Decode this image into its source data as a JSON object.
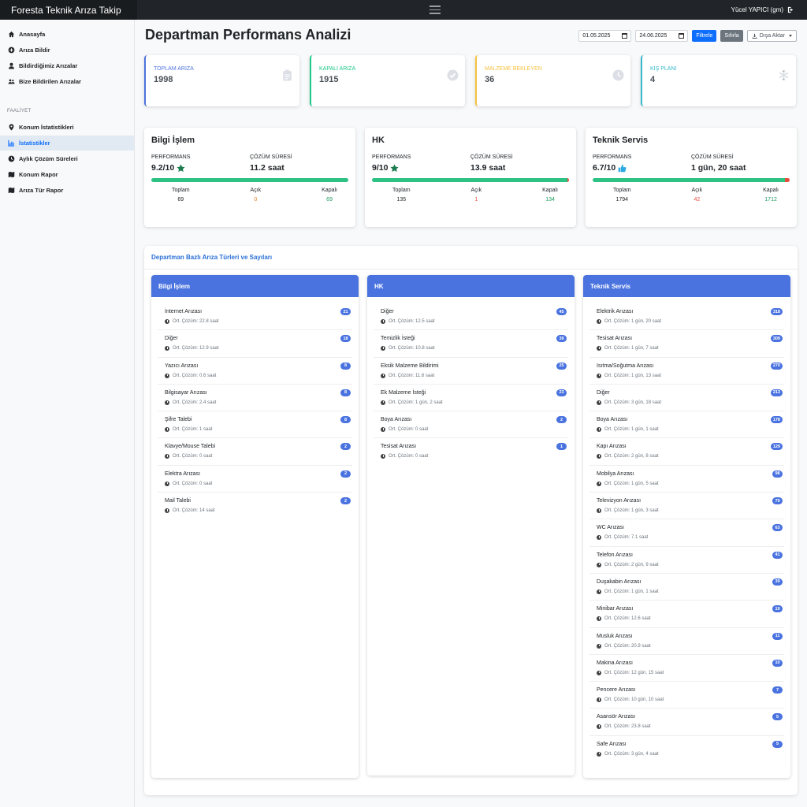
{
  "app": {
    "title": "Foresta Teknik Arıza Takip",
    "user": "Yücel YAPICI (gm)"
  },
  "sidebar": {
    "items": [
      {
        "label": "Anasayfa",
        "icon": "home-icon"
      },
      {
        "label": "Arıza Bildir",
        "icon": "plus-circle-icon"
      },
      {
        "label": "Bildirdiğimiz Arızalar",
        "icon": "user-icon"
      },
      {
        "label": "Bize Bildirilen Arızalar",
        "icon": "users-icon"
      }
    ],
    "heading": "FAALİYET",
    "activity": [
      {
        "label": "Konum İstatistikleri",
        "icon": "map-marker-icon"
      },
      {
        "label": "İstatistikler",
        "icon": "chart-icon",
        "active": true
      },
      {
        "label": "Aylık Çözüm Süreleri",
        "icon": "clock-icon"
      },
      {
        "label": "Konum Rapor",
        "icon": "map-icon"
      },
      {
        "label": "Arıza Tür Rapor",
        "icon": "map-icon"
      }
    ]
  },
  "page": {
    "title": "Departman Performans Analizi"
  },
  "filters": {
    "start_date": "01.05.2025",
    "end_date": "24.06.2025",
    "filter_label": "Filtrele",
    "reset_label": "Sıfırla",
    "export_label": "Dışa Aktar"
  },
  "stats": [
    {
      "label": "TOPLAM ARIZA",
      "value": "1998",
      "color": "#4e73df",
      "icon": "clipboard-icon"
    },
    {
      "label": "KAPALI ARIZA",
      "value": "1915",
      "color": "#1cc88a",
      "icon": "check-circle-icon"
    },
    {
      "label": "MALZEME BEKLEYEN",
      "value": "36",
      "color": "#f6c23e",
      "icon": "clock-icon"
    },
    {
      "label": "KIŞ PLANI",
      "value": "4",
      "color": "#36b9cc",
      "icon": "snowflake-icon"
    }
  ],
  "departments": [
    {
      "name": "Bilgi İşlem",
      "perf_label": "PERFORMANS",
      "perf": "9.2/10",
      "perf_icon": "star-icon",
      "time_label": "ÇÖZÜM SÜRESİ",
      "time": "11.2 saat",
      "total_label": "Toplam",
      "open_label": "Açık",
      "closed_label": "Kapalı",
      "total": "69",
      "open": "0",
      "closed": "69",
      "closed_ratio": 1.0
    },
    {
      "name": "HK",
      "perf_label": "PERFORMANS",
      "perf": "9/10",
      "perf_icon": "star-icon",
      "time_label": "ÇÖZÜM SÜRESİ",
      "time": "13.9 saat",
      "total_label": "Toplam",
      "open_label": "Açık",
      "closed_label": "Kapalı",
      "total": "135",
      "open": "1",
      "closed": "134",
      "closed_ratio": 0.9926
    },
    {
      "name": "Teknik Servis",
      "perf_label": "PERFORMANS",
      "perf": "6.7/10",
      "perf_icon": "thumbs-up-icon",
      "time_label": "ÇÖZÜM SÜRESİ",
      "time": "1 gün, 20 saat",
      "total_label": "Toplam",
      "open_label": "Açık",
      "closed_label": "Kapalı",
      "total": "1794",
      "open": "42",
      "closed": "1712",
      "closed_ratio": 0.976
    }
  ],
  "section": {
    "title": "Departman Bazlı Arıza Türleri ve Sayıları",
    "columns": [
      {
        "name": "Bilgi İşlem",
        "rows": [
          {
            "name": "İnternet Arızası",
            "time": "Ort. Çözüm: 22.8 saat",
            "count": "21"
          },
          {
            "name": "Diğer",
            "time": "Ort. Çözüm: 12.9 saat",
            "count": "18"
          },
          {
            "name": "Yazıcı Arızası",
            "time": "Ort. Çözüm: 0.6 saat",
            "count": "8"
          },
          {
            "name": "Bilgisayar Arızası",
            "time": "Ort. Çözüm: 2.4 saat",
            "count": "8"
          },
          {
            "name": "Şifre Talebi",
            "time": "Ort. Çözüm: 1 saat",
            "count": "8"
          },
          {
            "name": "Klavye/Mouse Talebi",
            "time": "Ort. Çözüm: 0 saat",
            "count": "2"
          },
          {
            "name": "Elektra Arızası",
            "time": "Ort. Çözüm: 0 saat",
            "count": "2"
          },
          {
            "name": "Mail Talebi",
            "time": "Ort. Çözüm: 14 saat",
            "count": "2"
          }
        ]
      },
      {
        "name": "HK",
        "rows": [
          {
            "name": "Diğer",
            "time": "Ort. Çözüm: 12.5 saat",
            "count": "45"
          },
          {
            "name": "Temizlik İsteği",
            "time": "Ort. Çözüm: 10.8 saat",
            "count": "39"
          },
          {
            "name": "Eksik Malzeme Bildirimi",
            "time": "Ort. Çözüm: 11.6 saat",
            "count": "25"
          },
          {
            "name": "Ek Malzeme İsteği",
            "time": "Ort. Çözüm: 1 gün, 2 saat",
            "count": "23"
          },
          {
            "name": "Boya Arızası",
            "time": "Ort. Çözüm: 0 saat",
            "count": "2"
          },
          {
            "name": "Tesisat Arızası",
            "time": "Ort. Çözüm: 0 saat",
            "count": "1"
          }
        ]
      },
      {
        "name": "Teknik Servis",
        "rows": [
          {
            "name": "Elektrik Arızası",
            "time": "Ort. Çözüm: 1 gün, 20 saat",
            "count": "318"
          },
          {
            "name": "Tesisat Arızası",
            "time": "Ort. Çözüm: 1 gün, 7 saat",
            "count": "309"
          },
          {
            "name": "Isıtma/Soğutma Arızası",
            "time": "Ort. Çözüm: 1 gün, 13 saat",
            "count": "270"
          },
          {
            "name": "Diğer",
            "time": "Ort. Çözüm: 3 gün, 18 saat",
            "count": "213"
          },
          {
            "name": "Boya Arızası",
            "time": "Ort. Çözüm: 1 gün, 1 saat",
            "count": "178"
          },
          {
            "name": "Kapı Arızası",
            "time": "Ort. Çözüm: 2 gün, 8 saat",
            "count": "129"
          },
          {
            "name": "Mobilya Arızası",
            "time": "Ort. Çözüm: 1 gün, 5 saat",
            "count": "98"
          },
          {
            "name": "Televizyon Arızası",
            "time": "Ort. Çözüm: 1 gün, 3 saat",
            "count": "79"
          },
          {
            "name": "WC Arızası",
            "time": "Ort. Çözüm: 7.1 saat",
            "count": "63"
          },
          {
            "name": "Telefon Arızası",
            "time": "Ort. Çözüm: 2 gün, 9 saat",
            "count": "41"
          },
          {
            "name": "Duşakabin Arızası",
            "time": "Ort. Çözüm: 1 gün, 1 saat",
            "count": "39"
          },
          {
            "name": "Minibar Arızası",
            "time": "Ort. Çözüm: 12.6 saat",
            "count": "19"
          },
          {
            "name": "Musluk Arızası",
            "time": "Ort. Çözüm: 20.9 saat",
            "count": "11"
          },
          {
            "name": "Makina Arızası",
            "time": "Ort. Çözüm: 12 gün, 15 saat",
            "count": "10"
          },
          {
            "name": "Pencere Arızası",
            "time": "Ort. Çözüm: 10 gün, 10 saat",
            "count": "7"
          },
          {
            "name": "Asansör Arızası",
            "time": "Ort. Çözüm: 23.8 saat",
            "count": "5"
          },
          {
            "name": "Safe Arızası",
            "time": "Ort. Çözüm: 3 gün, 4 saat",
            "count": "5"
          }
        ]
      }
    ]
  }
}
